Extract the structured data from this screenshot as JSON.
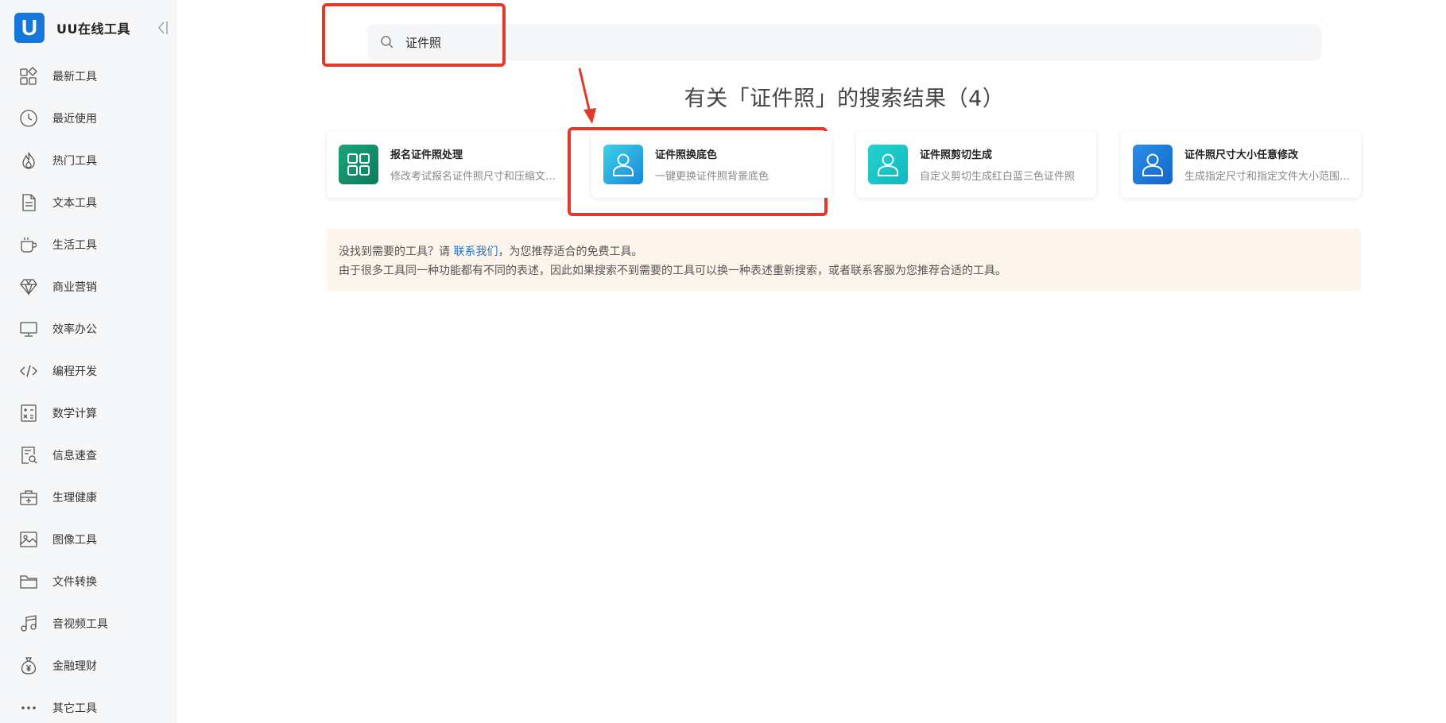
{
  "brand": {
    "logo_letter": "U",
    "title": "UU在线工具"
  },
  "sidebar": {
    "items": [
      {
        "label": "最新工具",
        "icon": "grid-shapes-icon"
      },
      {
        "label": "最近使用",
        "icon": "clock-icon"
      },
      {
        "label": "热门工具",
        "icon": "flame-icon"
      },
      {
        "label": "文本工具",
        "icon": "document-icon"
      },
      {
        "label": "生活工具",
        "icon": "coffee-cup-icon"
      },
      {
        "label": "商业营销",
        "icon": "diamond-icon"
      },
      {
        "label": "效率办公",
        "icon": "monitor-icon"
      },
      {
        "label": "编程开发",
        "icon": "code-icon"
      },
      {
        "label": "数学计算",
        "icon": "calculator-icon"
      },
      {
        "label": "信息速查",
        "icon": "search-document-icon"
      },
      {
        "label": "生理健康",
        "icon": "medical-kit-icon"
      },
      {
        "label": "图像工具",
        "icon": "image-icon"
      },
      {
        "label": "文件转换",
        "icon": "folder-icon"
      },
      {
        "label": "音视频工具",
        "icon": "music-note-icon"
      },
      {
        "label": "金融理财",
        "icon": "money-bag-icon"
      },
      {
        "label": "其它工具",
        "icon": "more-dots-icon"
      }
    ]
  },
  "search": {
    "value": "证件照"
  },
  "results": {
    "title": "有关「证件照」的搜索结果（4）",
    "cards": [
      {
        "title": "报名证件照处理",
        "desc": "修改考试报名证件照尺寸和压缩文件大小",
        "icon": "apps-grid-icon",
        "color_from": "#1aa47a",
        "color_to": "#0c7a5a"
      },
      {
        "title": "证件照换底色",
        "desc": "一键更换证件照背景底色",
        "icon": "person-icon",
        "color_from": "#3bd2e8",
        "color_to": "#1c86d8"
      },
      {
        "title": "证件照剪切生成",
        "desc": "自定义剪切生成红白蓝三色证件照",
        "icon": "person-icon",
        "color_from": "#25d3cf",
        "color_to": "#12b7c0"
      },
      {
        "title": "证件照尺寸大小任意修改",
        "desc": "生成指定尺寸和指定文件大小范围的证件照",
        "icon": "person-icon",
        "color_from": "#2a8fe6",
        "color_to": "#1565c8"
      }
    ]
  },
  "notice": {
    "line1_before": "没找到需要的工具？请 ",
    "link": "联系我们",
    "line1_after": "，为您推荐适合的免费工具。",
    "line2": "由于很多工具同一种功能都有不同的表述，因此如果搜索不到需要的工具可以换一种表述重新搜索，或者联系客服为您推荐合适的工具。"
  },
  "colors": {
    "accent": "#1677d9",
    "annotation": "#e23a2a",
    "notice_bg": "#fdf5ec",
    "link": "#1a73c9"
  }
}
